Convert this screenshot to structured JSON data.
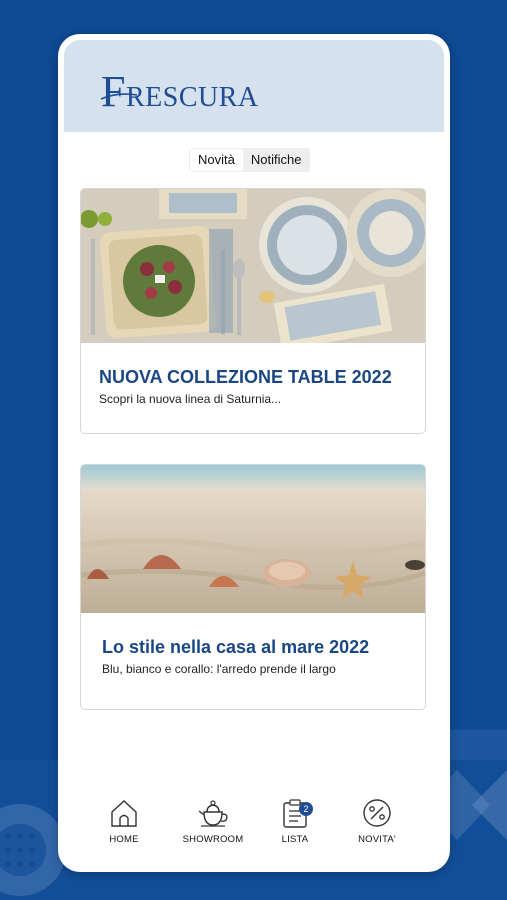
{
  "brand": {
    "logo_initial": "F",
    "logo_rest": "RESCURA"
  },
  "tabs": [
    {
      "label": "Novità",
      "active": true
    },
    {
      "label": "Notifiche",
      "active": false
    }
  ],
  "news": [
    {
      "title": "NUOVA COLLEZIONE TABLE 2022",
      "subtitle": "Scopri la nuova linea di Saturnia..."
    },
    {
      "title": "Lo stile nella casa al mare 2022",
      "subtitle": "Blu, bianco e corallo: l'arredo prende il largo"
    }
  ],
  "nav": {
    "home": "HOME",
    "showroom": "SHOWROOM",
    "lista": "LISTA",
    "lista_badge": "2",
    "novita": "NOVITA'"
  },
  "colors": {
    "brand_blue": "#1f4d94",
    "background": "#0f4a94",
    "header": "#d5e1ee"
  }
}
